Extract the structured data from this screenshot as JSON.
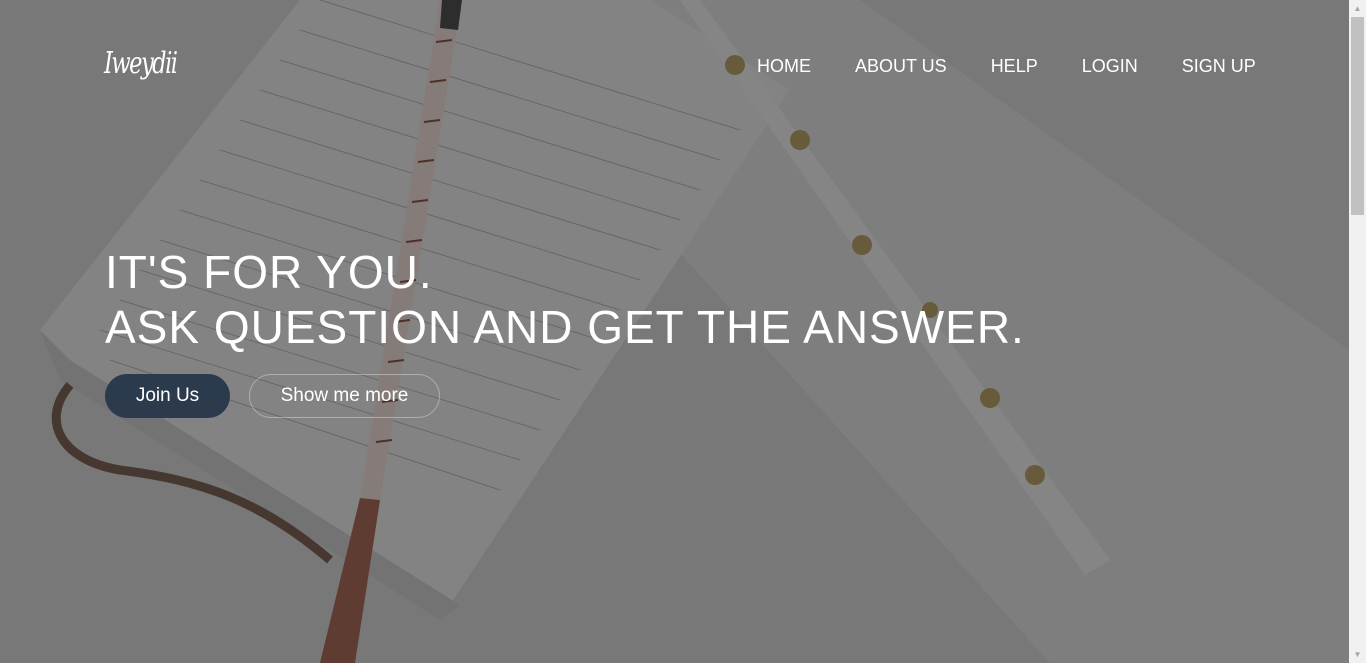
{
  "brand": {
    "logo_text": "Iweydii"
  },
  "nav": {
    "items": [
      {
        "label": "HOME"
      },
      {
        "label": "ABOUT US"
      },
      {
        "label": "HELP"
      },
      {
        "label": "LOGIN"
      },
      {
        "label": "SIGN UP"
      }
    ]
  },
  "hero": {
    "line1": "IT'S FOR YOU.",
    "line2": "ASK QUESTION AND GET THE ANSWER.",
    "primary_button": "Join Us",
    "secondary_button": "Show me more"
  },
  "colors": {
    "primary_button_bg": "#2b3a4d",
    "text": "#ffffff",
    "overlay": "rgba(40,40,40,0.55)"
  }
}
